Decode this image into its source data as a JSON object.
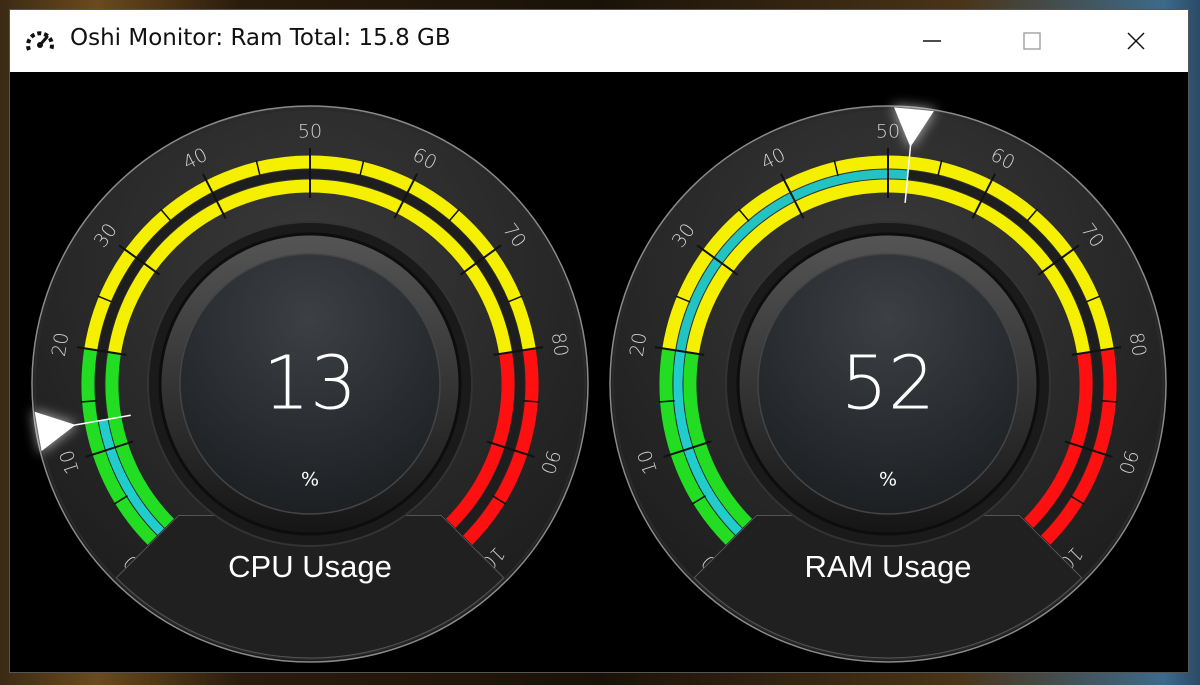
{
  "window": {
    "title": "Oshi Monitor: Ram Total: 15.8 GB",
    "app_icon": "speedometer-icon",
    "controls": {
      "minimize": "minimize-icon",
      "maximize": "maximize-icon",
      "close": "close-icon"
    }
  },
  "gauges": [
    {
      "id": "cpu",
      "title": "CPU Usage",
      "value": 13,
      "unit": "%",
      "min": 0,
      "max": 100
    },
    {
      "id": "ram",
      "title": "RAM Usage",
      "value": 52,
      "unit": "%",
      "min": 0,
      "max": 100
    }
  ],
  "scale": {
    "tick_labels": [
      "0",
      "10",
      "20",
      "30",
      "40",
      "50",
      "60",
      "70",
      "80",
      "90",
      "100"
    ],
    "zones": [
      {
        "from": 0,
        "to": 20,
        "color": "#22dd22"
      },
      {
        "from": 20,
        "to": 80,
        "color": "#f5f000"
      },
      {
        "from": 80,
        "to": 100,
        "color": "#ff1010"
      }
    ],
    "progress_color": "#22cccc"
  }
}
